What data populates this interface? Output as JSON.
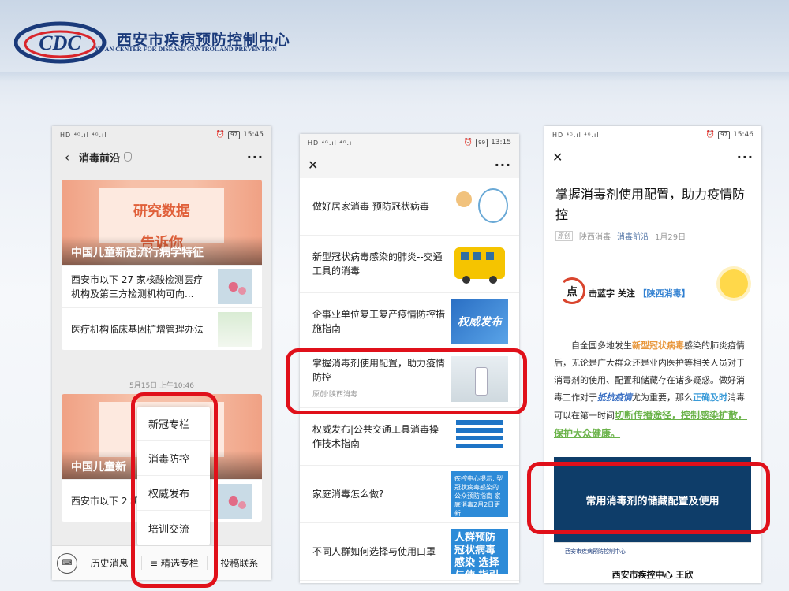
{
  "header": {
    "org_name": "西安市疾病预防控制中心",
    "org_name_en": "XI' AN CENTER FOR DISEASE CONTROL AND PREVENTION",
    "logo_text": "CDC"
  },
  "phone1": {
    "status_left": "HD ⁴ᴳ.ıl ⁴ᴳ.ıl",
    "battery": "97",
    "time": "15:45",
    "nav_title": "消毒前沿",
    "card1": {
      "hero_line1": "研究数据",
      "hero_line2": "告诉你",
      "hero_caption": "中国儿童新冠流行病学特征",
      "rows": [
        "西安市以下 27 家核酸检测医疗机构及第三方检测机构可向...",
        "医疗机构临床基因扩增管理办法"
      ]
    },
    "timestamp": "5月15日 上午10:46",
    "card2": {
      "hero_caption": "中国儿童新",
      "row": "西安市以下 2 机构及第三方"
    },
    "popup_items": [
      "新冠专栏",
      "消毒防控",
      "权威发布",
      "培训交流"
    ],
    "bottom_menu": {
      "history": "历史消息",
      "selected": "≡ 精选专栏",
      "submit": "投稿联系"
    }
  },
  "phone2": {
    "status_left": "HD ⁴ᴳ.ıl ⁴ᴳ.ıl",
    "battery": "99",
    "time": "13:15",
    "items": [
      {
        "title": "做好居家消毒 预防冠状病毒",
        "source": ""
      },
      {
        "title": "新型冠状病毒感染的肺炎--交通工具的消毒",
        "source": ""
      },
      {
        "title": "企事业单位复工复产疫情防控措施指南",
        "source": "",
        "thumb_text": "权威发布"
      },
      {
        "title": "掌握消毒剂使用配置，助力疫情防控",
        "source": "原创:陕西消毒"
      },
      {
        "title": "权威发布|公共交通工具消毒操作技术指南",
        "source": ""
      },
      {
        "title": "家庭消毒怎么做?",
        "source": "",
        "thumb_text": "疾控中心提示: 型冠状病毒感染的 公众预防指南 家庭消毒2月2日更新"
      },
      {
        "title": "不同人群如何选择与使用口罩",
        "source": "",
        "thumb_text": "人群预防 冠状病毒感染 选择与使 指引"
      }
    ]
  },
  "phone3": {
    "status_left": "HD ⁴ᴳ.ıl ⁴ᴳ.ıl",
    "battery": "97",
    "time": "15:46",
    "title": "掌握消毒剂使用配置，助力疫情防控",
    "meta": {
      "tag": "原创",
      "author": "陕西消毒",
      "account": "消毒前沿",
      "date": "1月29日"
    },
    "follow": {
      "dot": "点",
      "text1": "击蓝字 关注",
      "account": "【陕西消毒】"
    },
    "para": {
      "p1": "自全国多地发生",
      "hl1": "新型冠状病毒",
      "p2": "感染的肺炎疫情后，无论是广大群众还是业内医护等相关人员对于消毒剂的使用、配置和储藏存在诸多疑惑。做好消毒工作对于",
      "hl2": "抵抗疫情",
      "p3": "尤为重要，那么",
      "hl3": "正确及时",
      "p4": "消毒可以在第一时间",
      "hl4": "切断传播途径，控制感染扩散，保护大众健康。"
    },
    "banner": "常用消毒剂的储藏配置及使用",
    "mini_logo": "西安市疾病预防控制中心",
    "author_line": "西安市疾控中心 王欣"
  },
  "colors": {
    "highlight": "#e0101a",
    "banner": "#0e3d69",
    "brand": "#1a3a7a"
  }
}
